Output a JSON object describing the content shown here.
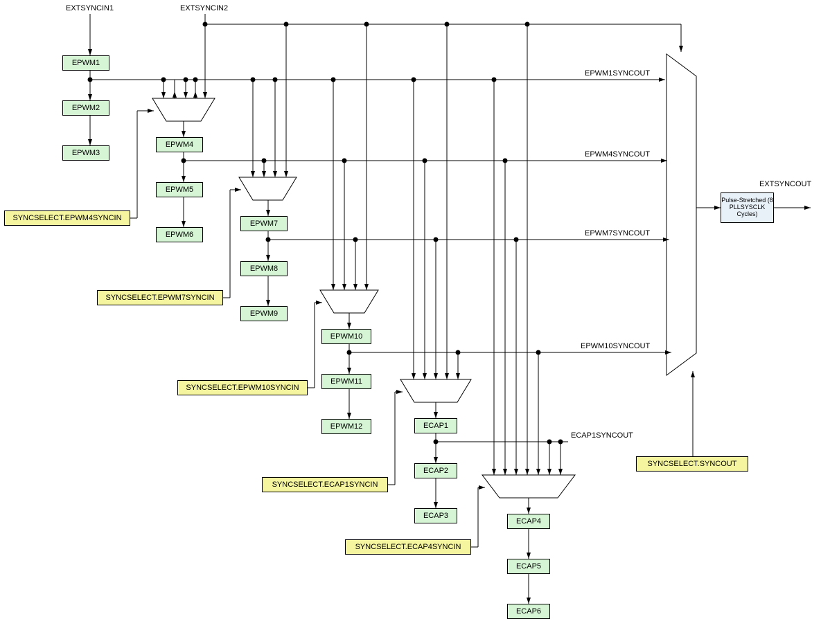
{
  "labels": {
    "extsyncin1": "EXTSYNCIN1",
    "extsyncin2": "EXTSYNCIN2",
    "syncout1": "EPWM1SYNCOUT",
    "syncout4": "EPWM4SYNCOUT",
    "syncout7": "EPWM7SYNCOUT",
    "syncout10": "EPWM10SYNCOUT",
    "ecapsyncout": "ECAP1SYNCOUT",
    "extsyncout": "EXTSYNCOUT"
  },
  "blocks": {
    "epwm1": "EPWM1",
    "epwm2": "EPWM2",
    "epwm3": "EPWM3",
    "epwm4": "EPWM4",
    "epwm5": "EPWM5",
    "epwm6": "EPWM6",
    "epwm7": "EPWM7",
    "epwm8": "EPWM8",
    "epwm9": "EPWM9",
    "epwm10": "EPWM10",
    "epwm11": "EPWM11",
    "epwm12": "EPWM12",
    "ecap1": "ECAP1",
    "ecap2": "ECAP2",
    "ecap3": "ECAP3",
    "ecap4": "ECAP4",
    "ecap5": "ECAP5",
    "ecap6": "ECAP6",
    "sel4": "SYNCSELECT.EPWM4SYNCIN",
    "sel7": "SYNCSELECT.EPWM7SYNCIN",
    "sel10": "SYNCSELECT.EPWM10SYNCIN",
    "selecap1": "SYNCSELECT.ECAP1SYNCIN",
    "selecap4": "SYNCSELECT.ECAP4SYNCIN",
    "selsyncout": "SYNCSELECT.SYNCOUT",
    "pulse": "Pulse-Stretched (8 PLLSYSCLK Cycles)"
  }
}
